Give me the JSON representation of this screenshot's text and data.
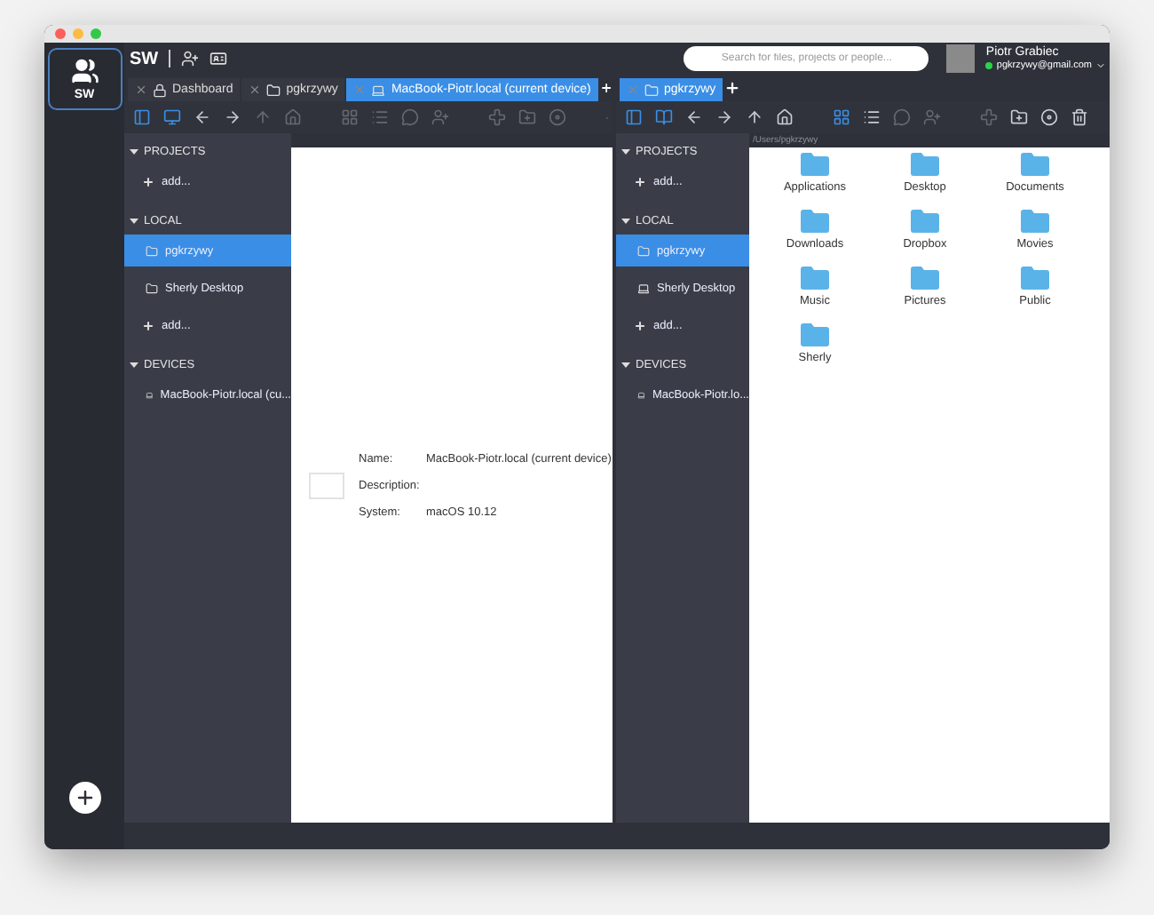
{
  "rail": {
    "app": {
      "label": "SW",
      "selected": true
    }
  },
  "header": {
    "title": "SW",
    "search": {
      "placeholder": "Search for files, projects or people..."
    },
    "user": {
      "name": "Piotr Grabiec",
      "email": "pgkrzywy@gmail.com",
      "online": true
    }
  },
  "panes": [
    {
      "tabs": [
        {
          "label": "Dashboard",
          "kind": "lock",
          "selected": false
        },
        {
          "label": "pgkrzywy",
          "kind": "folder",
          "selected": false
        },
        {
          "label": "MacBook-Piotr.local (current device)",
          "kind": "device",
          "selected": true
        }
      ],
      "toolbar": [
        [
          {
            "kind": "sidebar",
            "highlighted": true,
            "disabled": false
          },
          {
            "kind": "monitor",
            "highlighted": true,
            "disabled": false
          },
          {
            "kind": "back",
            "highlighted": false,
            "disabled": false
          },
          {
            "kind": "forward",
            "highlighted": false,
            "disabled": false
          },
          {
            "kind": "up",
            "highlighted": false,
            "disabled": true
          },
          {
            "kind": "home",
            "highlighted": false,
            "disabled": true
          }
        ],
        [
          {
            "kind": "grid",
            "highlighted": false,
            "disabled": true
          },
          {
            "kind": "list",
            "highlighted": false,
            "disabled": true
          },
          {
            "kind": "chat",
            "highlighted": false,
            "disabled": true
          },
          {
            "kind": "user-add",
            "highlighted": false,
            "disabled": true
          }
        ],
        [
          {
            "kind": "add",
            "highlighted": false,
            "disabled": true
          },
          {
            "kind": "folder-add",
            "highlighted": false,
            "disabled": true
          },
          {
            "kind": "collapse",
            "highlighted": false,
            "disabled": true
          }
        ]
      ],
      "sidebar": [
        {
          "title": "PROJECTS",
          "expanded": true,
          "items": [
            {
              "kind": "add",
              "label": "add...",
              "selected": false
            }
          ]
        },
        {
          "title": "LOCAL",
          "expanded": true,
          "items": [
            {
              "kind": "folder",
              "label": "pgkrzywy",
              "selected": true
            },
            {
              "kind": "folder",
              "label": "Sherly Desktop",
              "selected": false
            },
            {
              "kind": "add",
              "label": "add...",
              "selected": false
            }
          ]
        },
        {
          "title": "DEVICES",
          "expanded": true,
          "items": [
            {
              "kind": "device",
              "label": "MacBook-Piotr.local (cu...",
              "selected": false
            }
          ]
        }
      ],
      "content": {
        "kind": "details",
        "fields": [
          {
            "label": "Name:",
            "value": "MacBook-Piotr.local (current device)"
          },
          {
            "label": "Description:"
          },
          {
            "label": "System:",
            "value": "macOS 10.12"
          }
        ]
      }
    },
    {
      "tabs": [
        {
          "label": "pgkrzywy",
          "kind": "folder",
          "selected": true
        }
      ],
      "toolbar": [
        [
          {
            "kind": "sidebar",
            "highlighted": true,
            "disabled": false
          },
          {
            "kind": "book",
            "highlighted": true,
            "disabled": false
          },
          {
            "kind": "back",
            "highlighted": false,
            "disabled": false
          },
          {
            "kind": "forward",
            "highlighted": false,
            "disabled": false
          },
          {
            "kind": "up",
            "highlighted": false,
            "disabled": false
          },
          {
            "kind": "home",
            "highlighted": false,
            "disabled": false
          }
        ],
        [
          {
            "kind": "grid",
            "highlighted": true,
            "disabled": false
          },
          {
            "kind": "list",
            "highlighted": false,
            "disabled": false
          },
          {
            "kind": "chat",
            "highlighted": false,
            "disabled": true
          },
          {
            "kind": "user-add",
            "highlighted": false,
            "disabled": true
          }
        ],
        [
          {
            "kind": "add",
            "highlighted": false,
            "disabled": true
          },
          {
            "kind": "folder-add",
            "highlighted": false,
            "disabled": false
          },
          {
            "kind": "collapse",
            "highlighted": false,
            "disabled": false
          },
          {
            "kind": "trash",
            "highlighted": false,
            "disabled": false
          }
        ]
      ],
      "sidebar": [
        {
          "title": "PROJECTS",
          "expanded": true,
          "items": [
            {
              "kind": "add",
              "label": "add...",
              "selected": false
            }
          ]
        },
        {
          "title": "LOCAL",
          "expanded": true,
          "items": [
            {
              "kind": "folder",
              "label": "pgkrzywy",
              "selected": true
            },
            {
              "kind": "device",
              "label": "Sherly Desktop",
              "selected": false
            },
            {
              "kind": "add",
              "label": "add...",
              "selected": false
            }
          ]
        },
        {
          "title": "DEVICES",
          "expanded": true,
          "items": [
            {
              "kind": "device",
              "label": "MacBook-Piotr.lo...",
              "selected": false
            }
          ]
        }
      ],
      "content": {
        "kind": "files",
        "path": "/Users/pgkrzywy",
        "files": [
          {
            "name": "Applications"
          },
          {
            "name": "Desktop"
          },
          {
            "name": "Documents"
          },
          {
            "name": "Downloads"
          },
          {
            "name": "Dropbox"
          },
          {
            "name": "Movies"
          },
          {
            "name": "Music"
          },
          {
            "name": "Pictures"
          },
          {
            "name": "Public"
          },
          {
            "name": "Sherly"
          }
        ]
      }
    }
  ]
}
